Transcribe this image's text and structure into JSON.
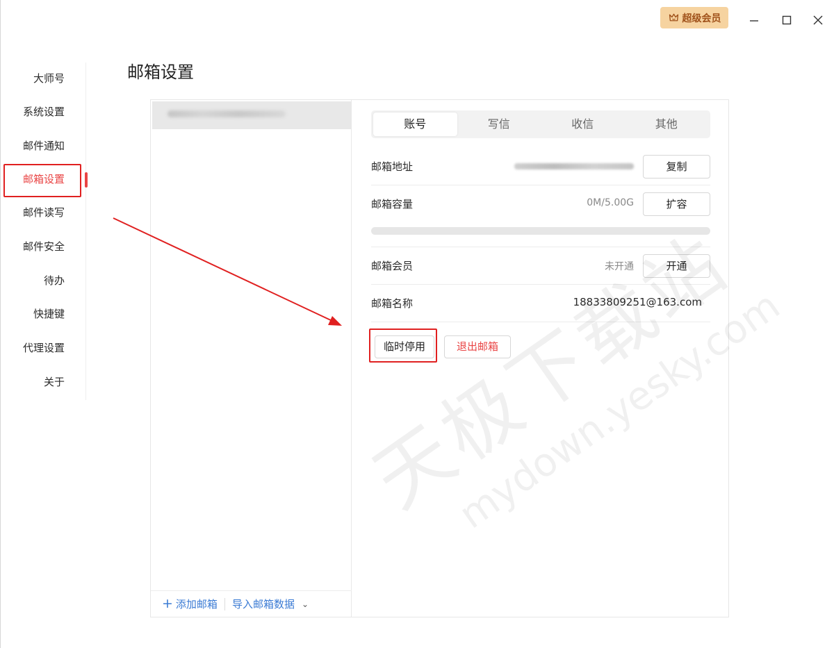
{
  "titlebar": {
    "vip_label": "超级会员",
    "icons": [
      "crown-icon",
      "minimize-icon",
      "maximize-icon",
      "close-icon"
    ]
  },
  "sidebar": {
    "items": [
      {
        "label": "大师号"
      },
      {
        "label": "系统设置"
      },
      {
        "label": "邮件通知"
      },
      {
        "label": "邮箱设置",
        "active": true
      },
      {
        "label": "邮件读写"
      },
      {
        "label": "邮件安全"
      },
      {
        "label": "待办"
      },
      {
        "label": "快捷键"
      },
      {
        "label": "代理设置"
      },
      {
        "label": "关于"
      }
    ]
  },
  "page": {
    "title": "邮箱设置"
  },
  "accounts": {
    "footer": {
      "add_label": "添加邮箱",
      "import_label": "导入邮箱数据"
    }
  },
  "tabs": [
    {
      "label": "账号",
      "active": true
    },
    {
      "label": "写信"
    },
    {
      "label": "收信"
    },
    {
      "label": "其他"
    }
  ],
  "settings": {
    "address": {
      "label": "邮箱地址",
      "button": "复制"
    },
    "capacity": {
      "label": "邮箱容量",
      "value": "0M/5.00G",
      "button": "扩容",
      "used_fraction": 0
    },
    "membership": {
      "label": "邮箱会员",
      "value": "未开通",
      "button": "开通"
    },
    "name": {
      "label": "邮箱名称",
      "value": "18833809251@163.com"
    }
  },
  "actions": {
    "pause": "临时停用",
    "quit": "退出邮箱"
  },
  "watermark": {
    "cn": "天极下载站",
    "url": "mydown.yesky.com"
  },
  "colors": {
    "accent_red": "#e94444",
    "link_blue": "#3b7bd4",
    "vip_bg": "#f6d3a0",
    "vip_text": "#a0521b"
  }
}
